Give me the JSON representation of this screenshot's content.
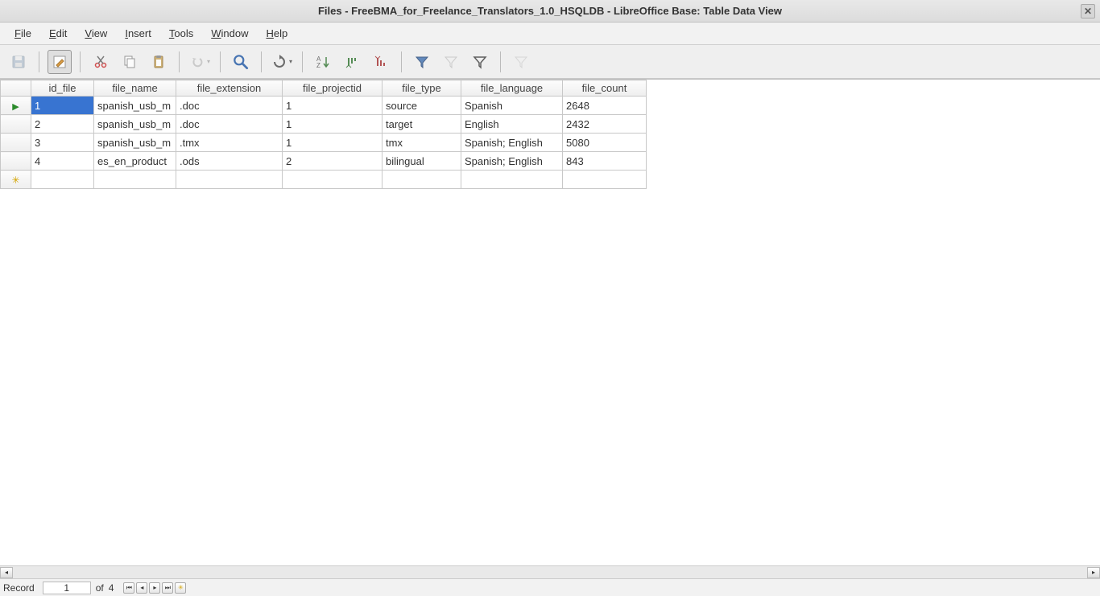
{
  "window": {
    "title": "Files - FreeBMA_for_Freelance_Translators_1.0_HSQLDB - LibreOffice Base: Table Data View"
  },
  "menus": {
    "file": {
      "label": "File",
      "accel": "F"
    },
    "edit": {
      "label": "Edit",
      "accel": "E"
    },
    "view": {
      "label": "View",
      "accel": "V"
    },
    "insert": {
      "label": "Insert",
      "accel": "I"
    },
    "tools": {
      "label": "Tools",
      "accel": "T"
    },
    "window": {
      "label": "Window",
      "accel": "W"
    },
    "help": {
      "label": "Help",
      "accel": "H"
    }
  },
  "toolbar_icons": {
    "save": "save-icon",
    "edit_data": "edit-data-icon",
    "cut": "cut-icon",
    "copy": "copy-icon",
    "paste": "paste-icon",
    "undo": "undo-icon",
    "find": "find-icon",
    "refresh": "refresh-icon",
    "sort": "sort-icon",
    "sort_asc": "sort-asc-icon",
    "sort_desc": "sort-desc-icon",
    "autofilter": "autofilter-icon",
    "apply_filter": "apply-filter-icon",
    "standard_filter": "standard-filter-icon",
    "remove_filter": "remove-filter-icon"
  },
  "columns": [
    {
      "key": "id_file",
      "label": "id_file"
    },
    {
      "key": "file_name",
      "label": "file_name"
    },
    {
      "key": "file_extension",
      "label": "file_extension"
    },
    {
      "key": "file_projectid",
      "label": "file_projectid"
    },
    {
      "key": "file_type",
      "label": "file_type"
    },
    {
      "key": "file_language",
      "label": "file_language"
    },
    {
      "key": "file_count",
      "label": "file_count"
    }
  ],
  "rows": [
    {
      "id_file": "1",
      "file_name": "spanish_usb_m",
      "file_extension": ".doc",
      "file_projectid": "1",
      "file_type": "source",
      "file_language": "Spanish",
      "file_count": "2648"
    },
    {
      "id_file": "2",
      "file_name": "spanish_usb_m",
      "file_extension": ".doc",
      "file_projectid": "1",
      "file_type": "target",
      "file_language": "English",
      "file_count": "2432"
    },
    {
      "id_file": "3",
      "file_name": "spanish_usb_m",
      "file_extension": ".tmx",
      "file_projectid": "1",
      "file_type": "tmx",
      "file_language": "Spanish; English",
      "file_count": "5080"
    },
    {
      "id_file": "4",
      "file_name": "es_en_product",
      "file_extension": ".ods",
      "file_projectid": "2",
      "file_type": "bilingual",
      "file_language": "Spanish; English",
      "file_count": "843"
    }
  ],
  "status": {
    "label": "Record",
    "current": "1",
    "of": "of",
    "total": "4"
  }
}
